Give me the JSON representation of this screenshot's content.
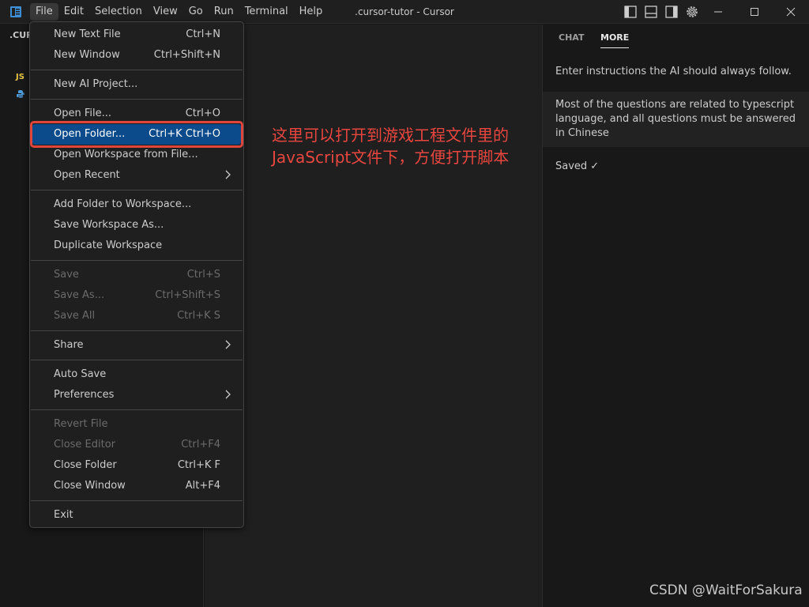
{
  "window": {
    "title": ".cursor-tutor - Cursor"
  },
  "menubar": [
    "File",
    "Edit",
    "Selection",
    "View",
    "Go",
    "Run",
    "Terminal",
    "Help"
  ],
  "explorer": {
    "title": ".CUR",
    "files": [
      {
        "icon": "javascript-file-icon",
        "badge": "JS",
        "color": "#e8c547"
      },
      {
        "icon": "python-file-icon",
        "color": "#4e9bd8"
      }
    ]
  },
  "file_menu": {
    "items": [
      {
        "label": "New Text File",
        "shortcut": "Ctrl+N"
      },
      {
        "label": "New Window",
        "shortcut": "Ctrl+Shift+N"
      },
      {
        "label": "New AI Project..."
      },
      {
        "label": "Open File...",
        "shortcut": "Ctrl+O"
      },
      {
        "label": "Open Folder...",
        "shortcut": "Ctrl+K Ctrl+O"
      },
      {
        "label": "Open Workspace from File..."
      },
      {
        "label": "Open Recent"
      },
      {
        "label": "Add Folder to Workspace..."
      },
      {
        "label": "Save Workspace As..."
      },
      {
        "label": "Duplicate Workspace"
      },
      {
        "label": "Save",
        "shortcut": "Ctrl+S"
      },
      {
        "label": "Save As...",
        "shortcut": "Ctrl+Shift+S"
      },
      {
        "label": "Save All",
        "shortcut": "Ctrl+K S"
      },
      {
        "label": "Share"
      },
      {
        "label": "Auto Save"
      },
      {
        "label": "Preferences"
      },
      {
        "label": "Revert File"
      },
      {
        "label": "Close Editor",
        "shortcut": "Ctrl+F4"
      },
      {
        "label": "Close Folder",
        "shortcut": "Ctrl+K F"
      },
      {
        "label": "Close Window",
        "shortcut": "Alt+F4"
      },
      {
        "label": "Exit"
      }
    ]
  },
  "right_panel": {
    "tabs": [
      "CHAT",
      "MORE"
    ],
    "description": "Enter instructions the AI should always follow.",
    "instructions": "Most of the questions are related to typescript language, and all questions must be answered in Chinese",
    "saved": "Saved ✓"
  },
  "annotation": {
    "line1": "这里可以打开到游戏工程文件里的",
    "line2": "JavaScript文件下，方便打开脚本"
  },
  "watermark": "CSDN @WaitForSakura",
  "colors": {
    "accent": "#0b4a8b",
    "annotation": "#e8463f"
  }
}
